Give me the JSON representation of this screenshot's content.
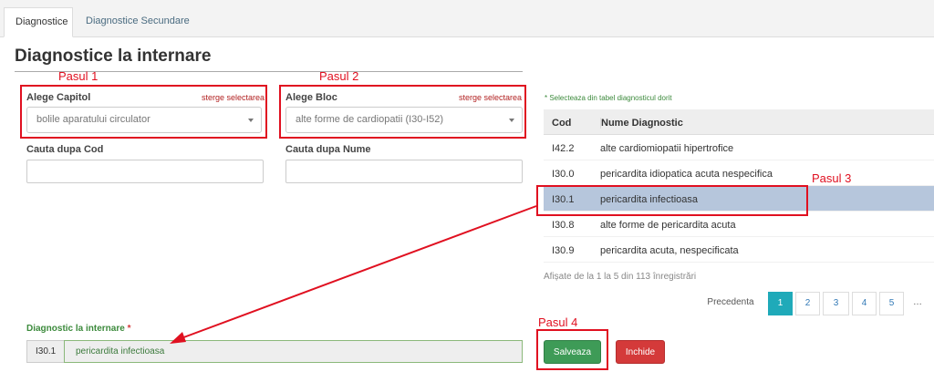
{
  "tabs": [
    {
      "label": "Diagnostice"
    },
    {
      "label": "Diagnostice Secundare"
    }
  ],
  "page_title": "Diagnostice la internare",
  "steps": {
    "s1": "Pasul 1",
    "s2": "Pasul 2",
    "s3": "Pasul 3",
    "s4": "Pasul 4"
  },
  "capitol": {
    "label": "Alege Capitol",
    "clear": "sterge selectarea",
    "value": "bolile aparatului circulator"
  },
  "bloc": {
    "label": "Alege Bloc",
    "clear": "sterge selectarea",
    "value": "alte forme de cardiopatii (I30-I52)"
  },
  "search_code": {
    "label": "Cauta dupa Cod",
    "value": ""
  },
  "search_name": {
    "label": "Cauta dupa Nume",
    "value": ""
  },
  "table": {
    "hint": "* Selecteaza din tabel diagnosticul dorit",
    "headers": {
      "code": "Cod",
      "name": "Nume Diagnostic"
    },
    "rows": [
      {
        "code": "I42.2",
        "name": "alte cardiomiopatii hipertrofice"
      },
      {
        "code": "I30.0",
        "name": "pericardita idiopatica acuta nespecifica"
      },
      {
        "code": "I30.1",
        "name": "pericardita infectioasa"
      },
      {
        "code": "I30.8",
        "name": "alte forme de pericardita acuta"
      },
      {
        "code": "I30.9",
        "name": "pericardita acuta, nespecificata"
      }
    ],
    "selected_row": 2,
    "info": "Afișate de la 1 la 5 din 113 înregistrări"
  },
  "pagination": {
    "prev": "Precedenta",
    "pages": [
      "1",
      "2",
      "3",
      "4",
      "5"
    ],
    "more": "…",
    "active_page": "1"
  },
  "diagnostic": {
    "label": "Diagnostic la internare",
    "required": "*",
    "code": "I30.1",
    "name": "pericardita infectioasa"
  },
  "buttons": {
    "save": "Salveaza",
    "close": "Inchide"
  },
  "colors": {
    "annotation_red": "#e01020",
    "selected_row": "#b6c6dc",
    "save": "#3e9b57",
    "close": "#d43a3a",
    "active_page": "#1faab9"
  }
}
